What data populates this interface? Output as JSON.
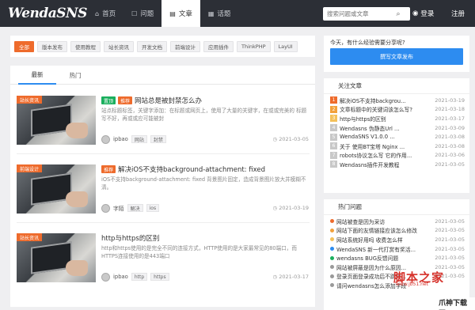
{
  "header": {
    "logo": "WendaSNS",
    "nav": [
      {
        "icon": "⌂",
        "label": "首页",
        "active": false
      },
      {
        "icon": "☐",
        "label": "问题",
        "active": false
      },
      {
        "icon": "▤",
        "label": "文章",
        "active": true
      },
      {
        "icon": "▦",
        "label": "话题",
        "active": false
      }
    ],
    "search_placeholder": "搜索问题或文章",
    "login_label": "登录",
    "register_label": "注册"
  },
  "categories": [
    "全部",
    "版本发布",
    "使用教程",
    "站长资讯",
    "开发文档",
    "前端设计",
    "应用插件",
    "ThinkPHP",
    "LayUI"
  ],
  "tabs": [
    "最新",
    "热门"
  ],
  "articles": [
    {
      "corner_tag": "站长资讯",
      "badges": [
        {
          "type": "top",
          "label": "置顶"
        },
        {
          "type": "hot",
          "label": "推荐"
        }
      ],
      "title": "网站总是被封禁怎么办",
      "excerpt": "站点标题标签，关键字添加：在标题或网页上，使用了大量的关键字，在或或完美的 标题写不好，再或或应可能被封",
      "author": "ipbao",
      "tags": [
        "网站",
        "封禁"
      ],
      "date": "2021-03-05"
    },
    {
      "corner_tag": "前端设计",
      "badges": [
        {
          "type": "hot",
          "label": "推荐"
        }
      ],
      "title": "解决iOS不支持background-attachment: fixed",
      "excerpt": "iOS不支持background-attachment: fixed 背景图片固定，造成背景图片放大并模糊不清。",
      "author": "字陌",
      "tags": [
        "解决",
        "ios"
      ],
      "date": "2021-03-19"
    },
    {
      "corner_tag": "站长资讯",
      "badges": [],
      "title": "http与https的区别",
      "excerpt": "http和https使用的是完全不同的连接方式，HTTP使用的是大家最常见的80端口，而HTTPS连接使用的是443端口",
      "author": "ipbao",
      "tags": [
        "http",
        "https"
      ],
      "date": "2021-03-17"
    }
  ],
  "ask": {
    "prompt": "今天，有什么经验需要分享呢?",
    "button": "撰写文章发布"
  },
  "recommend": {
    "title": "关注文章",
    "items": [
      {
        "n": "1",
        "text": "解决iOS不支持backgrou...",
        "date": "2021-03-19"
      },
      {
        "n": "2",
        "text": "文章标题中的关键词该怎么写?",
        "date": "2021-03-18"
      },
      {
        "n": "3",
        "text": "http与https的区别",
        "date": "2021-03-17"
      },
      {
        "n": "4",
        "text": "Wendasns 伪静态Url ...",
        "date": "2021-03-09"
      },
      {
        "n": "5",
        "text": "WendaSNS V1.0.0 ...",
        "date": "2021-03-08"
      },
      {
        "n": "6",
        "text": "关于 使用BT宝塔 Nginx ...",
        "date": "2021-03-08"
      },
      {
        "n": "7",
        "text": "robots协议怎么写 它的作用...",
        "date": "2021-03-06"
      },
      {
        "n": "8",
        "text": "Wendasns插件开发教程",
        "date": "2021-03-05"
      }
    ]
  },
  "hot_questions": {
    "title": "热门问题",
    "items": [
      {
        "color": "#ee6b2c",
        "text": "网站被查是因为采访",
        "date": "2021-03-05"
      },
      {
        "color": "#f2a13b",
        "text": "网站下面的友情链接应该怎么修改",
        "date": "2021-03-05"
      },
      {
        "color": "#f4c15a",
        "text": "网站系统好用吗 收费怎么样",
        "date": "2021-03-05"
      },
      {
        "color": "#2d8cf0",
        "text": "WendaSNS 新一代打赏有奖活...",
        "date": "2021-03-05"
      },
      {
        "color": "#1aaf5d",
        "text": "wendasns BUG反馈问题",
        "date": "2021-03-05"
      },
      {
        "color": "#999999",
        "text": "网站被屏蔽是因为什么原因...",
        "date": "2021-03-05"
      },
      {
        "color": "#999999",
        "text": "登录页面登录成功后不跳转...",
        "date": "2021-03-05"
      },
      {
        "color": "#999999",
        "text": "请问wendasns怎么添加字段",
        "date": ""
      }
    ]
  },
  "watermarks": {
    "main": "脚本之家",
    "sub": "www.jb51.net",
    "corner": "爪神下载网"
  },
  "colors": {
    "navbar": "#2c2f36",
    "accent_orange": "#ee6b2c",
    "accent_blue": "#2d8cf0",
    "top_green": "#1aaf5d"
  }
}
